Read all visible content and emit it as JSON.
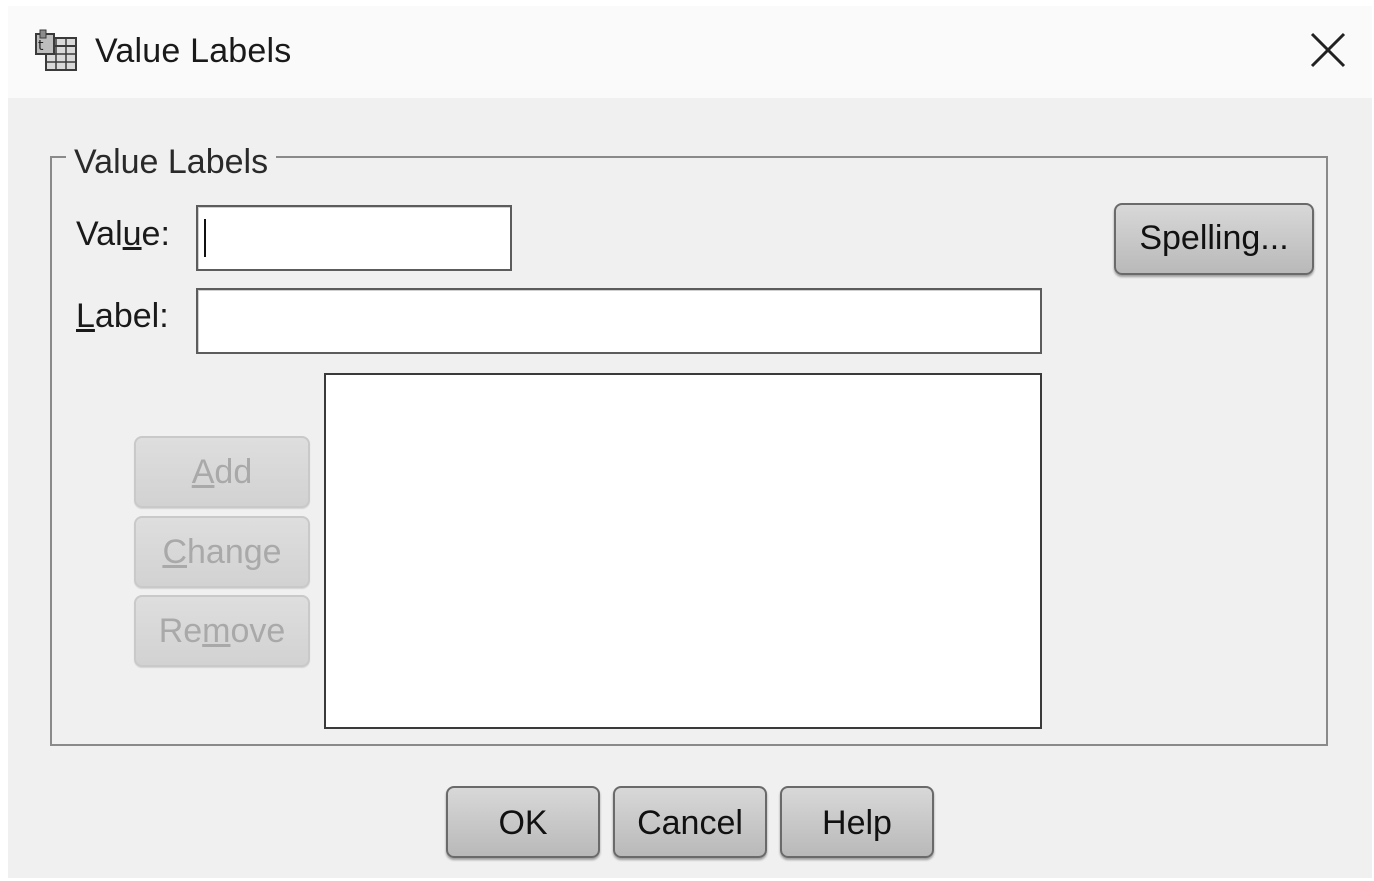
{
  "window": {
    "title": "Value Labels",
    "icon": "spss-table-icon",
    "close_icon": "close-icon"
  },
  "group": {
    "legend": "Value Labels"
  },
  "fields": {
    "value": {
      "label_pre": "Val",
      "label_mnemonic": "u",
      "label_post": "e:",
      "value": ""
    },
    "label": {
      "label_pre": "",
      "label_mnemonic": "L",
      "label_post": "abel:",
      "value": ""
    }
  },
  "list": {
    "items": []
  },
  "side_buttons": {
    "add": {
      "pre": "",
      "mnemonic": "A",
      "post": "dd",
      "enabled": false
    },
    "change": {
      "pre": "",
      "mnemonic": "C",
      "post": "hange",
      "enabled": false
    },
    "remove": {
      "pre": "Re",
      "mnemonic": "m",
      "post": "ove",
      "enabled": false
    }
  },
  "spelling_button": {
    "label": "Spelling..."
  },
  "footer_buttons": {
    "ok": "OK",
    "cancel": "Cancel",
    "help": "Help"
  },
  "colors": {
    "dialog_bg": "#f0f0f0",
    "titlebar_bg": "#fafafa",
    "button_face": "#c8c8c8",
    "disabled_text": "#a9a9a9"
  }
}
